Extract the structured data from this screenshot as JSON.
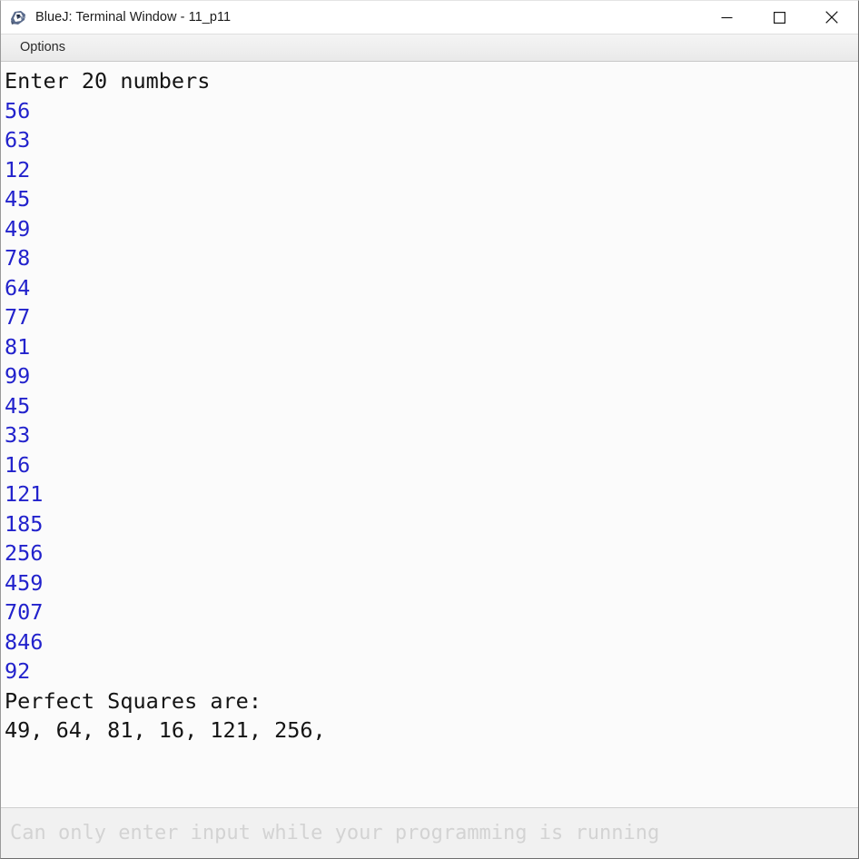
{
  "window": {
    "title": "BlueJ: Terminal Window - 11_p11",
    "icon": "bluej-penguin-icon",
    "controls": {
      "minimize_label": "Minimize",
      "maximize_label": "Maximize",
      "close_label": "Close"
    }
  },
  "menubar": {
    "items": [
      {
        "label": "Options",
        "name": "menu-item-options"
      }
    ]
  },
  "terminal": {
    "colors": {
      "output_text": "#141414",
      "input_text": "#2222cc",
      "background": "#fbfbfb"
    },
    "lines": [
      {
        "text": "Enter 20 numbers",
        "kind": "out"
      },
      {
        "text": "56",
        "kind": "in"
      },
      {
        "text": "63",
        "kind": "in"
      },
      {
        "text": "12",
        "kind": "in"
      },
      {
        "text": "45",
        "kind": "in"
      },
      {
        "text": "49",
        "kind": "in"
      },
      {
        "text": "78",
        "kind": "in"
      },
      {
        "text": "64",
        "kind": "in"
      },
      {
        "text": "77",
        "kind": "in"
      },
      {
        "text": "81",
        "kind": "in"
      },
      {
        "text": "99",
        "kind": "in"
      },
      {
        "text": "45",
        "kind": "in"
      },
      {
        "text": "33",
        "kind": "in"
      },
      {
        "text": "16",
        "kind": "in"
      },
      {
        "text": "121",
        "kind": "in"
      },
      {
        "text": "185",
        "kind": "in"
      },
      {
        "text": "256",
        "kind": "in"
      },
      {
        "text": "459",
        "kind": "in"
      },
      {
        "text": "707",
        "kind": "in"
      },
      {
        "text": "846",
        "kind": "in"
      },
      {
        "text": "92",
        "kind": "in"
      },
      {
        "text": "Perfect Squares are:",
        "kind": "out"
      },
      {
        "text": "49, 64, 81, 16, 121, 256,",
        "kind": "out"
      }
    ]
  },
  "statusbar": {
    "message": "Can only enter input while your programming is running",
    "color": "#d3d3d3"
  }
}
